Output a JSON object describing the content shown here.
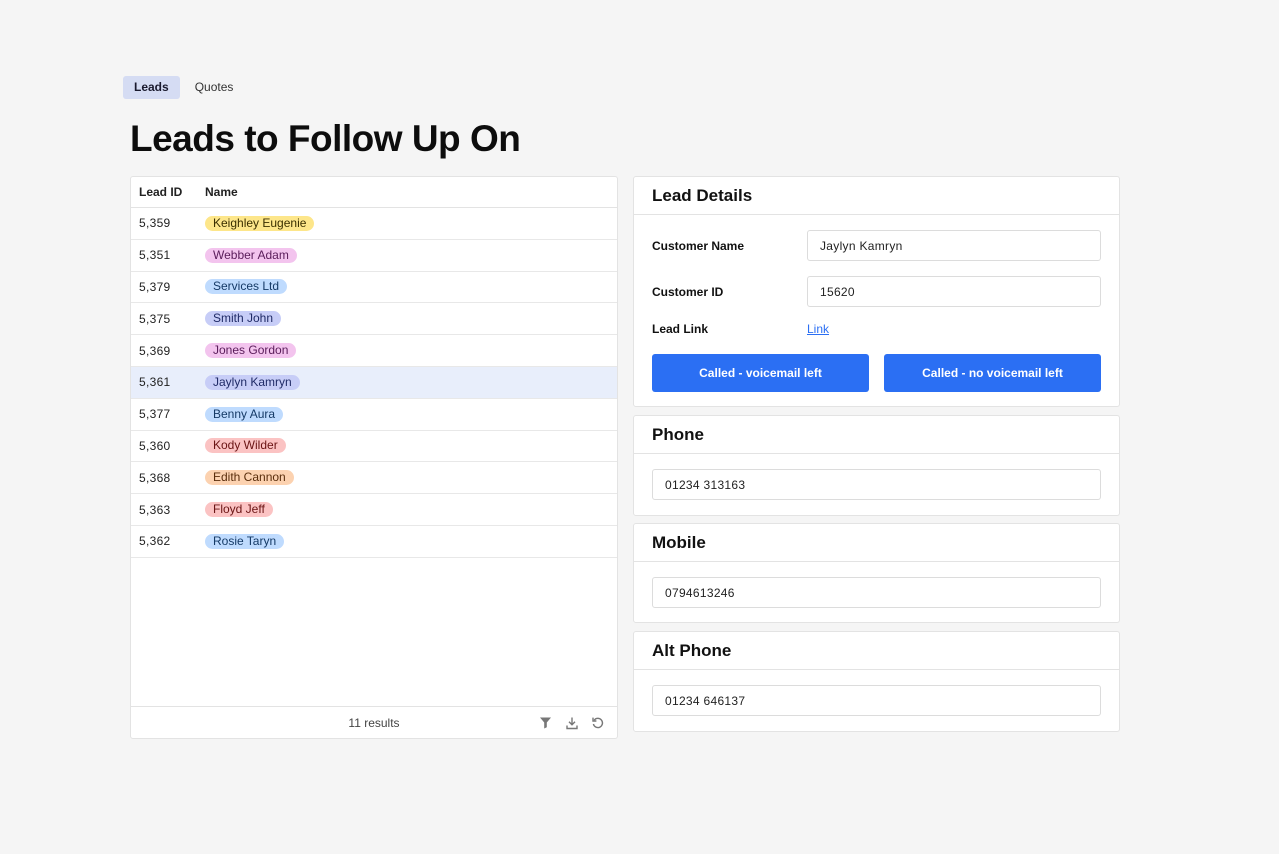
{
  "tabs": [
    {
      "label": "Leads",
      "active": true
    },
    {
      "label": "Quotes",
      "active": false
    }
  ],
  "page_title": "Leads to Follow Up On",
  "table": {
    "columns": [
      "Lead ID",
      "Name"
    ],
    "rows": [
      {
        "id": "5,359",
        "name": "Keighley Eugenie",
        "bg": "#fde68a",
        "fg": "#3a2f00"
      },
      {
        "id": "5,351",
        "name": "Webber Adam",
        "bg": "#f3c4ee",
        "fg": "#5a1c5a"
      },
      {
        "id": "5,379",
        "name": "Services Ltd",
        "bg": "#bfdbfe",
        "fg": "#153a66"
      },
      {
        "id": "5,375",
        "name": "Smith John",
        "bg": "#c7cdf7",
        "fg": "#1f2a66"
      },
      {
        "id": "5,369",
        "name": "Jones Gordon",
        "bg": "#f3c4ee",
        "fg": "#5a1c5a"
      },
      {
        "id": "5,361",
        "name": "Jaylyn Kamryn",
        "bg": "#c7cdf7",
        "fg": "#1f2a66"
      },
      {
        "id": "5,377",
        "name": "Benny Aura",
        "bg": "#bfdbfe",
        "fg": "#153a66"
      },
      {
        "id": "5,360",
        "name": "Kody Wilder",
        "bg": "#fbc3c3",
        "fg": "#6a1414"
      },
      {
        "id": "5,368",
        "name": "Edith Cannon",
        "bg": "#fcd2b0",
        "fg": "#5a2e0c"
      },
      {
        "id": "5,363",
        "name": "Floyd Jeff",
        "bg": "#fbc3c3",
        "fg": "#6a1414"
      },
      {
        "id": "5,362",
        "name": "Rosie Taryn",
        "bg": "#bfdbfe",
        "fg": "#153a66"
      }
    ],
    "selected_index": 5,
    "footer_text": "11 results"
  },
  "lead_details": {
    "title": "Lead Details",
    "customer_name_label": "Customer Name",
    "customer_name_value": "Jaylyn Kamryn",
    "customer_id_label": "Customer ID",
    "customer_id_value": "15620",
    "lead_link_label": "Lead Link",
    "lead_link_text": "Link",
    "btn_voicemail": "Called - voicemail left",
    "btn_no_voicemail": "Called - no voicemail left"
  },
  "phone": {
    "title": "Phone",
    "value": "01234 313163"
  },
  "mobile": {
    "title": "Mobile",
    "value": "0794613246"
  },
  "alt_phone": {
    "title": "Alt Phone",
    "value": "01234 646137"
  },
  "colors": {
    "accent": "#2b6ff3",
    "selected_row": "#e8eefb",
    "active_tab": "#d5dcf3"
  }
}
